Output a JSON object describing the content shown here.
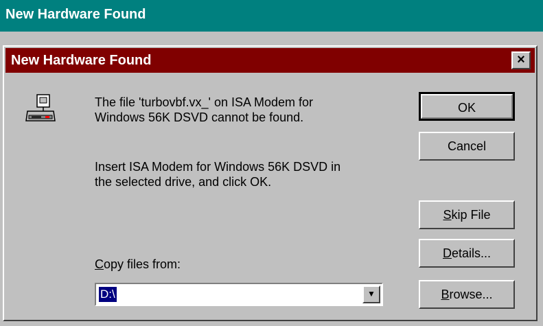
{
  "background_window": {
    "title": "New Hardware Found"
  },
  "dialog": {
    "title": "New Hardware Found",
    "close_label": "×",
    "message1_line1": "The file 'turbovbf.vx_' on ISA Modem for",
    "message1_line2": "Windows 56K DSVD cannot be found.",
    "message2_line1": "Insert ISA Modem for Windows 56K DSVD in",
    "message2_line2": "the selected drive, and click OK.",
    "copy_label_mnemonic": "C",
    "copy_label_rest": "opy files from:",
    "copy_value": "D:\\",
    "icon": "modem-drive-icon",
    "buttons": {
      "ok": "OK",
      "cancel": "Cancel",
      "skip_mnemonic": "S",
      "skip_rest": "kip File",
      "details_mnemonic": "D",
      "details_rest": "etails...",
      "browse_mnemonic": "B",
      "browse_rest": "rowse..."
    }
  },
  "colors": {
    "background_titlebar": "#00807f",
    "dialog_titlebar": "#800000",
    "face": "#c0c0c0",
    "selection": "#000080"
  }
}
